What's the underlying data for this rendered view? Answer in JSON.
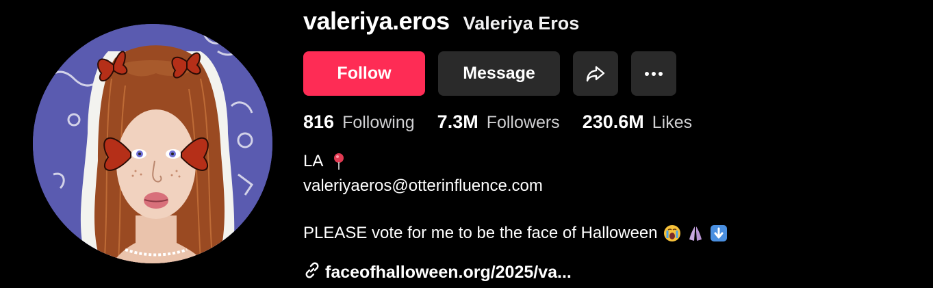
{
  "profile": {
    "username": "valeriya.eros",
    "display_name": "Valeriya Eros",
    "avatar_icon": "profile-avatar-illustration"
  },
  "actions": {
    "follow_label": "Follow",
    "message_label": "Message",
    "share_icon": "share-arrow-icon",
    "more_icon": "more-dots-icon"
  },
  "stats": [
    {
      "value": "816",
      "label": "Following"
    },
    {
      "value": "7.3M",
      "label": "Followers"
    },
    {
      "value": "230.6M",
      "label": "Likes"
    }
  ],
  "bio": {
    "location": "LA",
    "location_icon": "round-pushpin-icon",
    "email": "valeriyaeros@otterinfluence.com",
    "vote_text": "PLEASE vote for me to be the face of Halloween",
    "vote_emojis": [
      "crying-face-icon",
      "folded-hands-icon",
      "down-arrow-icon"
    ]
  },
  "link": {
    "text": "faceofhalloween.org/2025/va...",
    "icon": "link-icon"
  },
  "colors": {
    "background": "#000000",
    "follow_button": "#fe2c55",
    "secondary_button": "#2a2a2a",
    "avatar_background": "#5a5bb0",
    "hair": "#9a4a22"
  }
}
